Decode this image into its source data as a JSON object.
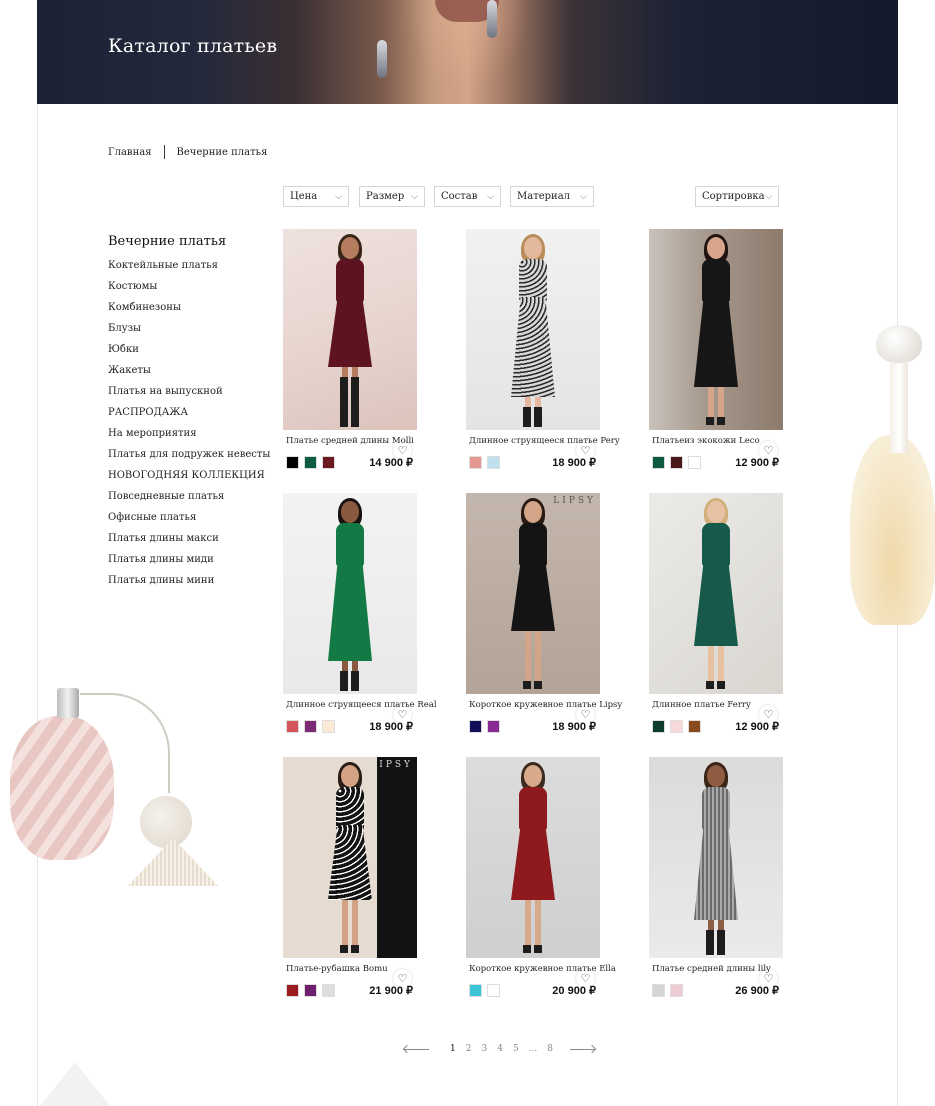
{
  "hero": {
    "title": "Каталог платьев"
  },
  "breadcrumb": {
    "home": "Главная",
    "current": "Вечерние платья"
  },
  "filters": {
    "price": "Цена",
    "size": "Размер",
    "composition": "Состав",
    "material": "Материал",
    "sort": "Сортировка"
  },
  "sidebar": {
    "title": "Вечерние платья",
    "items": [
      {
        "label": "Коктейльные платья"
      },
      {
        "label": "Костюмы"
      },
      {
        "label": "Комбинезоны"
      },
      {
        "label": "Блузы"
      },
      {
        "label": "Юбки"
      },
      {
        "label": "Жакеты"
      },
      {
        "label": "Платья на выпускной"
      },
      {
        "label": "РАСПРОДАЖА"
      },
      {
        "label": "На мероприятия"
      },
      {
        "label": "Платья для подружек невесты"
      },
      {
        "label": "НОВОГОДНЯЯ КОЛЛЕКЦИЯ"
      },
      {
        "label": "Повседневные платья"
      },
      {
        "label": "Офисные платья"
      },
      {
        "label": "Платья длины макси"
      },
      {
        "label": "Платья длины миди"
      },
      {
        "label": "Платья длины мини"
      }
    ]
  },
  "products": [
    {
      "name": "Платье средней длины Molli",
      "price": "14 900 ₽",
      "swatches": [
        "#000000",
        "#0d5b43",
        "#6b1a22"
      ]
    },
    {
      "name": "Длинное струящееся платье Pery",
      "price": "18 900 ₽",
      "swatches": [
        "#e59690",
        "#bfe0ef"
      ]
    },
    {
      "name": "Платьеиз экокожи Leco",
      "price": "12 900 ₽",
      "swatches": [
        "#0e5a40",
        "#4a1a1a",
        "#ffffff"
      ]
    },
    {
      "name": "Длинное струящееся платье Real",
      "price": "18 900 ₽",
      "swatches": [
        "#d4545a",
        "#7b2a73",
        "#fbead5"
      ]
    },
    {
      "name": "Короткое кружевное платье Lipsy",
      "price": "18 900 ₽",
      "swatches": [
        "#0f0f5a",
        "#8a2a94"
      ],
      "brand": "LIPSY"
    },
    {
      "name": "Длинное платье Ferry",
      "price": "12 900 ₽",
      "swatches": [
        "#0c3c2e",
        "#f7d9d9",
        "#8a4a1e"
      ]
    },
    {
      "name": "Платье-рубашка Bomu",
      "price": "21 900 ₽",
      "swatches": [
        "#9c1b1e",
        "#6e1f6e",
        "#dddddd"
      ],
      "brand": "LIPSY"
    },
    {
      "name": "Короткое кружевное платье Ella",
      "price": "20 900 ₽",
      "swatches": [
        "#3bc3d6",
        "#ffffff"
      ]
    },
    {
      "name": "Платье средней длины lily",
      "price": "26 900 ₽",
      "swatches": [
        "#d4d4d4",
        "#efcbd3"
      ]
    }
  ],
  "pagination": {
    "pages": [
      "1",
      "2",
      "3",
      "4",
      "5",
      "...",
      "8"
    ],
    "current": "1"
  },
  "icons": {
    "favorite": "heart-icon",
    "dropdown": "chevron-down-icon",
    "prev": "arrow-left-icon",
    "next": "arrow-right-icon"
  }
}
